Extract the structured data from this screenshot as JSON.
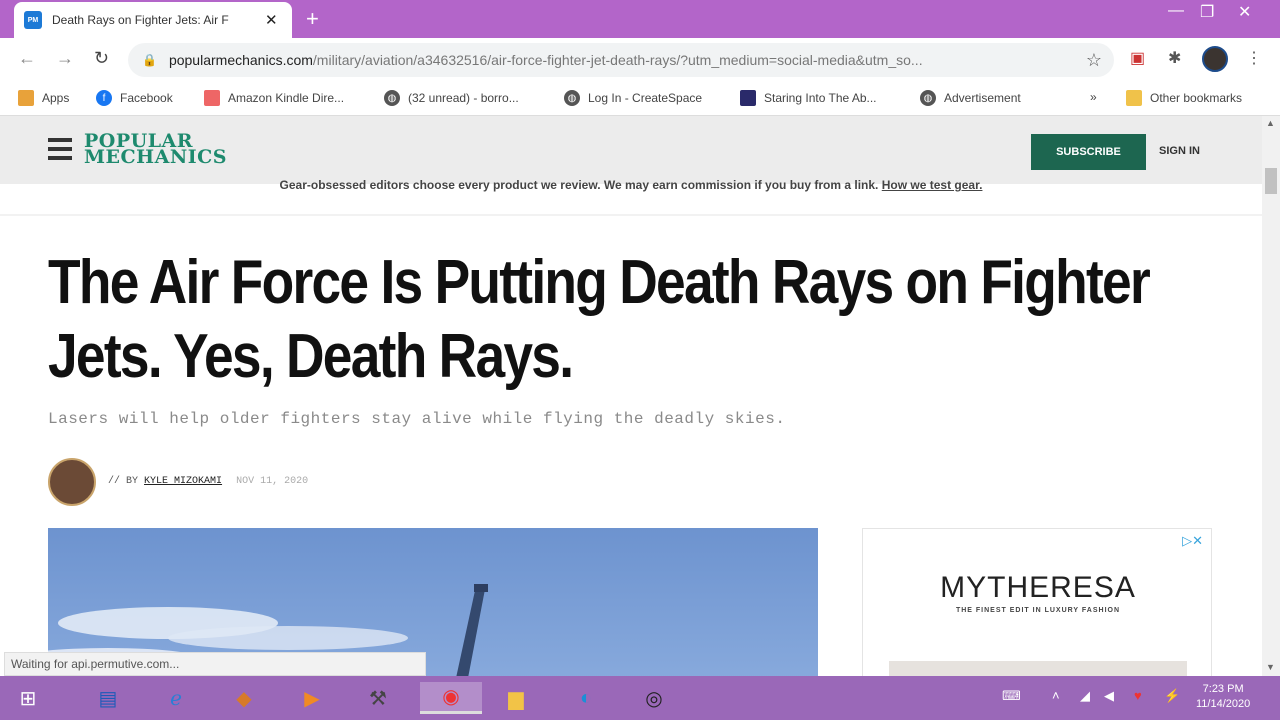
{
  "browser": {
    "tab_title": "Death Rays on Fighter Jets: Air F",
    "favicon_text": "PM",
    "url_domain": "popularmechanics.com",
    "url_path": "/military/aviation/a34632516/air-force-fighter-jet-death-rays/?utm_medium=social-media&utm_so...",
    "status_text": "Waiting for api.permutive.com..."
  },
  "bookmarks": [
    {
      "label": "Apps",
      "icon": "apps-grid-icon"
    },
    {
      "label": "Facebook",
      "icon": "facebook-icon"
    },
    {
      "label": "Amazon Kindle Dire...",
      "icon": "kindle-icon"
    },
    {
      "label": "(32 unread) - borro...",
      "icon": "globe-icon"
    },
    {
      "label": "Log In - CreateSpace",
      "icon": "globe-icon"
    },
    {
      "label": "Staring Into The Ab...",
      "icon": "blog-icon"
    },
    {
      "label": "Advertisement",
      "icon": "globe-icon"
    },
    {
      "label": "»",
      "icon": ""
    },
    {
      "label": "Other bookmarks",
      "icon": "folder-icon"
    }
  ],
  "site": {
    "logo_line1": "POPULAR",
    "logo_line2": "MECHANICS",
    "subscribe_label": "SUBSCRIBE",
    "signin_label": "SIGN IN",
    "disclaimer": "Gear-obsessed editors choose every product we review. We may earn commission if you buy from a link.",
    "disclaimer_link": "How we test gear."
  },
  "article": {
    "headline": "The Air Force Is Putting Death Rays on Fighter Jets. Yes, Death Rays.",
    "dek": "Lasers will help older fighters stay alive while flying the deadly skies.",
    "byline_prefix": "// BY",
    "author": "KYLE MIZOKAMI",
    "date": "NOV 11, 2020"
  },
  "ad": {
    "brand": "MYTHERESA",
    "tagline": "THE FINEST EDIT IN LUXURY FASHION",
    "adchoices": "▷✕"
  },
  "taskbar": {
    "time": "7:23 PM",
    "date": "11/14/2020"
  },
  "colors": {
    "titlebar": "#b365c9",
    "taskbar": "#9a68b8",
    "brand_green": "#1e8a6e",
    "subscribe_bg": "#1d6650"
  }
}
